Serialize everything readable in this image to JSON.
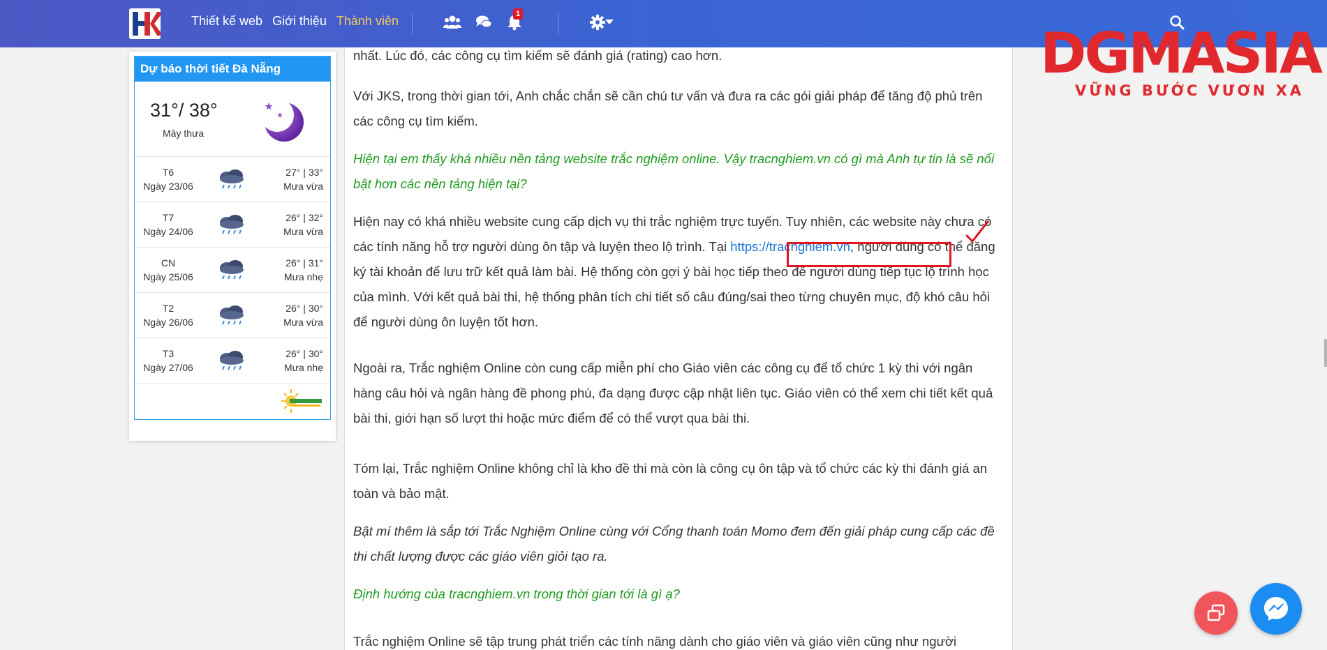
{
  "navbar": {
    "logo_text": "HK",
    "links": [
      "Thiết kế web",
      "Giới thiệu",
      "Thành viên"
    ],
    "active_link_index": 2,
    "notification_count": "1",
    "icons": [
      "users-icon",
      "chat-icon",
      "bell-icon",
      "gear-icon",
      "caret-down-icon",
      "search-icon"
    ],
    "colors": {
      "bar_left": "#4c58c4",
      "bar_right": "#3a6ad8",
      "active": "#f7c65c"
    }
  },
  "brand": {
    "name": "DGMASIA",
    "slogan": "VỮNG BƯỚC VƯƠN XA",
    "color": "#e0282d"
  },
  "weather": {
    "title": "Dự báo thời tiết Đà Nẵng",
    "now": {
      "temp": "31°/ 38°",
      "condition": "Mây thưa",
      "icon": "moon-icon"
    },
    "days": [
      {
        "day": "T6",
        "date": "Ngày 23/06",
        "temp": "27° | 33°",
        "condition": "Mưa vừa",
        "icon": "rain-cloud-icon"
      },
      {
        "day": "T7",
        "date": "Ngày 24/06",
        "temp": "26° | 32°",
        "condition": "Mưa vừa",
        "icon": "rain-cloud-icon"
      },
      {
        "day": "CN",
        "date": "Ngày 25/06",
        "temp": "26° | 31°",
        "condition": "Mưa nhẹ",
        "icon": "rain-cloud-icon"
      },
      {
        "day": "T2",
        "date": "Ngày 26/06",
        "temp": "26° | 30°",
        "condition": "Mưa vừa",
        "icon": "rain-cloud-icon"
      },
      {
        "day": "T3",
        "date": "Ngày 27/06",
        "temp": "26° | 30°",
        "condition": "Mưa nhẹ",
        "icon": "rain-cloud-icon"
      }
    ],
    "colors": {
      "header": "#2196f3"
    }
  },
  "article": {
    "p1": "nhất. Lúc đó, các công cụ tìm kiếm sẽ đánh giá (rating) cao hơn.",
    "p2": "Với JKS, trong thời gian tới, Anh chắc chắn sẽ cần chú tư vấn và đưa ra các gói giải pháp để tăng độ phủ trên các công cụ tìm kiếm.",
    "q1": "Hiện tại em thấy khá nhiều nền tảng website trắc nghiệm online. Vậy tracnghiem.vn có gì mà Anh tự tin là sẽ nổi bật hơn các nền tảng hiện tại?",
    "p3_before": "Hiện nay có khá nhiều website cung cấp dịch vụ thi trắc nghiệm trực tuyến. Tuy nhiên, các website này chưa có các tính năng hỗ trợ người dùng ôn tập và luyện theo lộ trình. Tại ",
    "p3_link": "https://tracnghiem.vn",
    "p3_after": ", người dùng có thể đăng ký tài khoản để lưu trữ kết quả làm bài. Hệ thống còn gợi ý bài học tiếp theo để người dùng tiếp tục lộ trình học của mình. Với kết quả bài thi, hệ thống phân tích chi tiết số câu đúng/sai theo từng chuyên mục, độ khó câu hỏi để người dùng ôn luyện tốt hơn.",
    "p4": "Ngoài ra, Trắc nghiệm Online còn cung cấp miễn phí cho Giáo viên các công cụ để tổ chức 1 kỳ thi với ngân hàng câu hỏi và ngân hàng đề phong phú, đa dạng được cập nhật liên tục. Giáo viên có thể xem chi tiết kết quả bài thi, giới hạn số lượt thi hoặc mức điểm để có thể vượt qua bài thi.",
    "p5": "Tóm lại, Trắc nghiệm Online không chỉ là kho đề thi mà còn là công cụ ôn tập và tổ chức các kỳ thi đánh giá an toàn và bảo mật.",
    "p6": "Bật mí thêm là sắp tới Trắc Nghiệm Online cùng với Cổng thanh toán Momo đem đến giải pháp cung cấp các đề thi chất lượng được các giáo viên giỏi tạo ra.",
    "q2": "Định hướng của tracnghiem.vn trong thời gian tới là gì ạ?",
    "p7": "Trắc nghiệm Online sẽ tập trung phát triển các tính năng dành cho giáo viên và giáo viên cũng như người",
    "colors": {
      "question": "#1f9a1f",
      "link": "#1a73d9",
      "highlight": "#e0141f"
    }
  },
  "floating": {
    "icons": [
      "multi-window-icon",
      "messenger-icon"
    ],
    "colors": {
      "share": "#f0555a",
      "messenger": "#1a8cf2"
    }
  }
}
